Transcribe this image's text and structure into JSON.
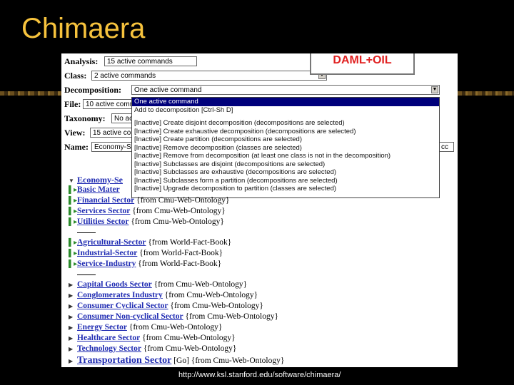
{
  "slide": {
    "title": "Chimaera",
    "footer_url": "http://www.ksl.stanford.edu/software/chimaera/"
  },
  "callout": {
    "text": "DAML+OIL",
    "color": "#e02020"
  },
  "form": {
    "analysis": {
      "label": "Analysis:",
      "value": "15 active commands"
    },
    "class": {
      "label": "Class:",
      "value": "2 active commands"
    },
    "decomposition": {
      "label": "Decomposition:",
      "value": "One active command"
    },
    "file": {
      "label": "File:",
      "value": "10 active commands"
    },
    "taxonomy": {
      "label": "Taxonomy:",
      "value": "No active"
    },
    "view": {
      "label": "View:",
      "value": "15 active comm"
    },
    "name": {
      "label": "Name:",
      "value": "Economy-Se...",
      "right_fragment": "cc"
    }
  },
  "menu": {
    "items": [
      "One active command",
      "Add to decomposition [Ctrl-Sh D]",
      "[Inactive] Create disjoint decomposition   (decompositions are selected)",
      "[Inactive] Create exhaustive decomposition   (decompositions are selected)",
      "[Inactive] Create partition   (decompositions are selected)",
      "[Inactive] Remove decomposition   (classes are selected)",
      "[Inactive] Remove from decomposition   (at least one class is not in the decomposition)",
      "[Inactive] Subclasses are disjoint   (decompositions are selected)",
      "[Inactive] Subclasses are exhaustive   (decompositions are selected)",
      "[Inactive] Subclasses form a partition   (decompositions are selected)",
      "[Inactive] Upgrade decomposition to partition   (classes are selected)"
    ]
  },
  "tree": {
    "root": {
      "label": "Economy-Se"
    },
    "group1": [
      {
        "label": "Basic Mater",
        "src": ""
      },
      {
        "label": "Financial Sector",
        "src": "{from Cmu-Web-Ontology}"
      },
      {
        "label": "Services Sector",
        "src": "{from Cmu-Web-Ontology}"
      },
      {
        "label": "Utilities Sector",
        "src": "{from Cmu-Web-Ontology}"
      }
    ],
    "group2": [
      {
        "label": "Agricultural-Sector",
        "src": "{from World-Fact-Book}"
      },
      {
        "label": "Industrial-Sector",
        "src": "{from World-Fact-Book}"
      },
      {
        "label": "Service-Industry",
        "src": "{from World-Fact-Book}"
      }
    ],
    "group3": [
      {
        "label": "Capital Goods Sector",
        "src": "{from Cmu-Web-Ontology}"
      },
      {
        "label": "Conglomerates Industry",
        "src": "{from Cmu-Web-Ontology}"
      },
      {
        "label": "Consumer Cyclical Sector",
        "src": "{from Cmu-Web-Ontology}"
      },
      {
        "label": "Consumer Non-cyclical Sector",
        "src": "{from Cmu-Web-Ontology}"
      },
      {
        "label": "Energy Sector",
        "src": "{from Cmu-Web-Ontology}"
      },
      {
        "label": "Healthcare Sector",
        "src": "{from Cmu-Web-Ontology}"
      },
      {
        "label": "Technology Sector",
        "src": "{from Cmu-Web-Ontology}"
      },
      {
        "label": "Transportation Sector",
        "src": "[Go] {from Cmu-Web-Ontology}"
      }
    ]
  }
}
